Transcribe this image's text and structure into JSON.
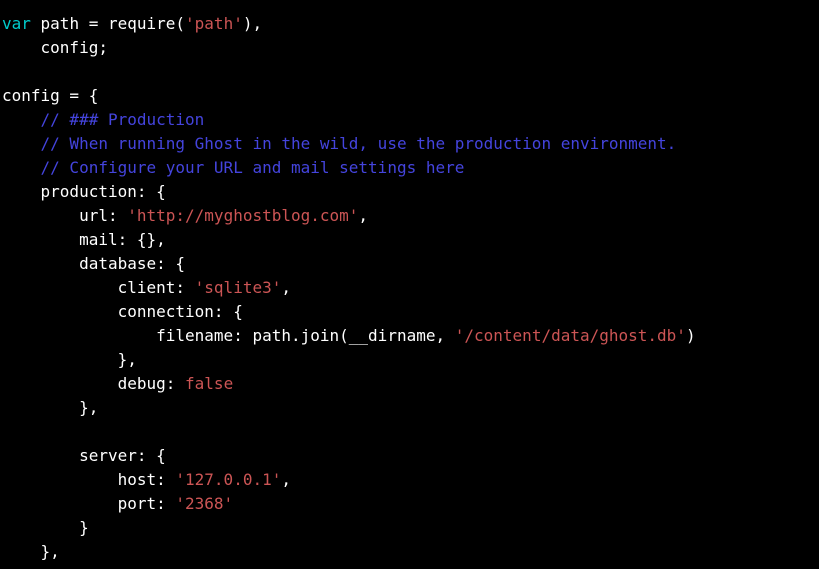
{
  "code": {
    "l1_var": "var",
    "l1_path": " path = require(",
    "l1_str": "'path'",
    "l1_end": "),",
    "l2": "    config;",
    "l3": "",
    "l4": "config = {",
    "l5": "    // ### Production",
    "l6": "    // When running Ghost in the wild, use the production environment.",
    "l7": "    // Configure your URL and mail settings here",
    "l8": "    production: {",
    "l9_a": "        url: ",
    "l9_str": "'http://myghostblog.com'",
    "l9_b": ",",
    "l10": "        mail: {},",
    "l11": "        database: {",
    "l12_a": "            client: ",
    "l12_str": "'sqlite3'",
    "l12_b": ",",
    "l13": "            connection: {",
    "l14_a": "                filename: path.join(__dirname, ",
    "l14_str": "'/content/data/ghost.db'",
    "l14_b": ")",
    "l15": "            },",
    "l16_a": "            debug: ",
    "l16_lit": "false",
    "l17": "        },",
    "l18": "",
    "l19": "        server: {",
    "l20_a": "            host: ",
    "l20_str": "'127.0.0.1'",
    "l20_b": ",",
    "l21_a": "            port: ",
    "l21_str": "'2368'",
    "l22": "        }",
    "l23": "    },"
  }
}
